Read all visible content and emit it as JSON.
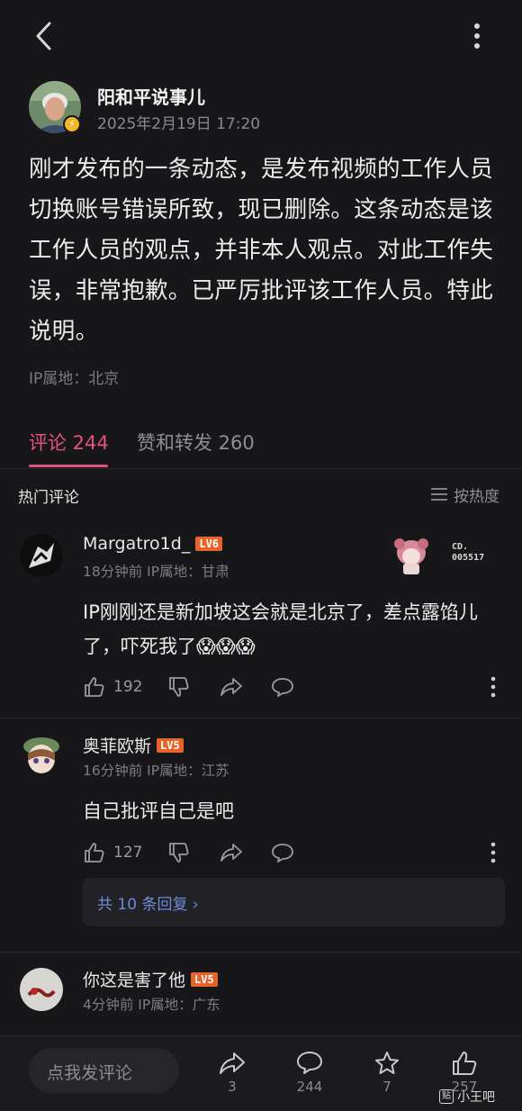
{
  "post": {
    "author": "阳和平说事儿",
    "time": "2025年2月19日 17:20",
    "body": "刚才发布的一条动态，是发布视频的工作人员切换账号错误所致，现已删除。这条动态是该工作人员的观点，并非本人观点。对此工作失误，非常抱歉。已严厉批评该工作人员。特此说明。",
    "ip": "IP属地：北京"
  },
  "tabs": {
    "comments": "评论 244",
    "likes_reposts": "赞和转发 260"
  },
  "section": {
    "hot_title": "热门评论",
    "sort_label": "按热度"
  },
  "comments": [
    {
      "name": "Margatro1d_",
      "level": "LV6",
      "meta": "18分钟前 IP属地：甘肃",
      "text": "IP刚刚还是新加坡这会就是北京了，差点露馅儿了，吓死我了😱😱😱",
      "likes": "192",
      "decoration_text": "CD.\n005517"
    },
    {
      "name": "奥菲欧斯",
      "level": "LV5",
      "meta": "16分钟前 IP属地：江苏",
      "text": "自己批评自己是吧",
      "likes": "127",
      "replies_label": "共 10 条回复 ›"
    },
    {
      "name": "你这是害了他",
      "level": "LV5",
      "meta": "4分钟前 IP属地：广东"
    }
  ],
  "bottom": {
    "input_placeholder": "点我发评论",
    "reposts": "3",
    "comments": "244",
    "favorites": "7",
    "likes": "257"
  },
  "watermark": {
    "logo": "贴",
    "text": "小王吧"
  },
  "colors": {
    "accent": "#e4527f",
    "level_badge": "#e7632a",
    "link": "#6c8bd8",
    "verified": "#f3b62b"
  }
}
